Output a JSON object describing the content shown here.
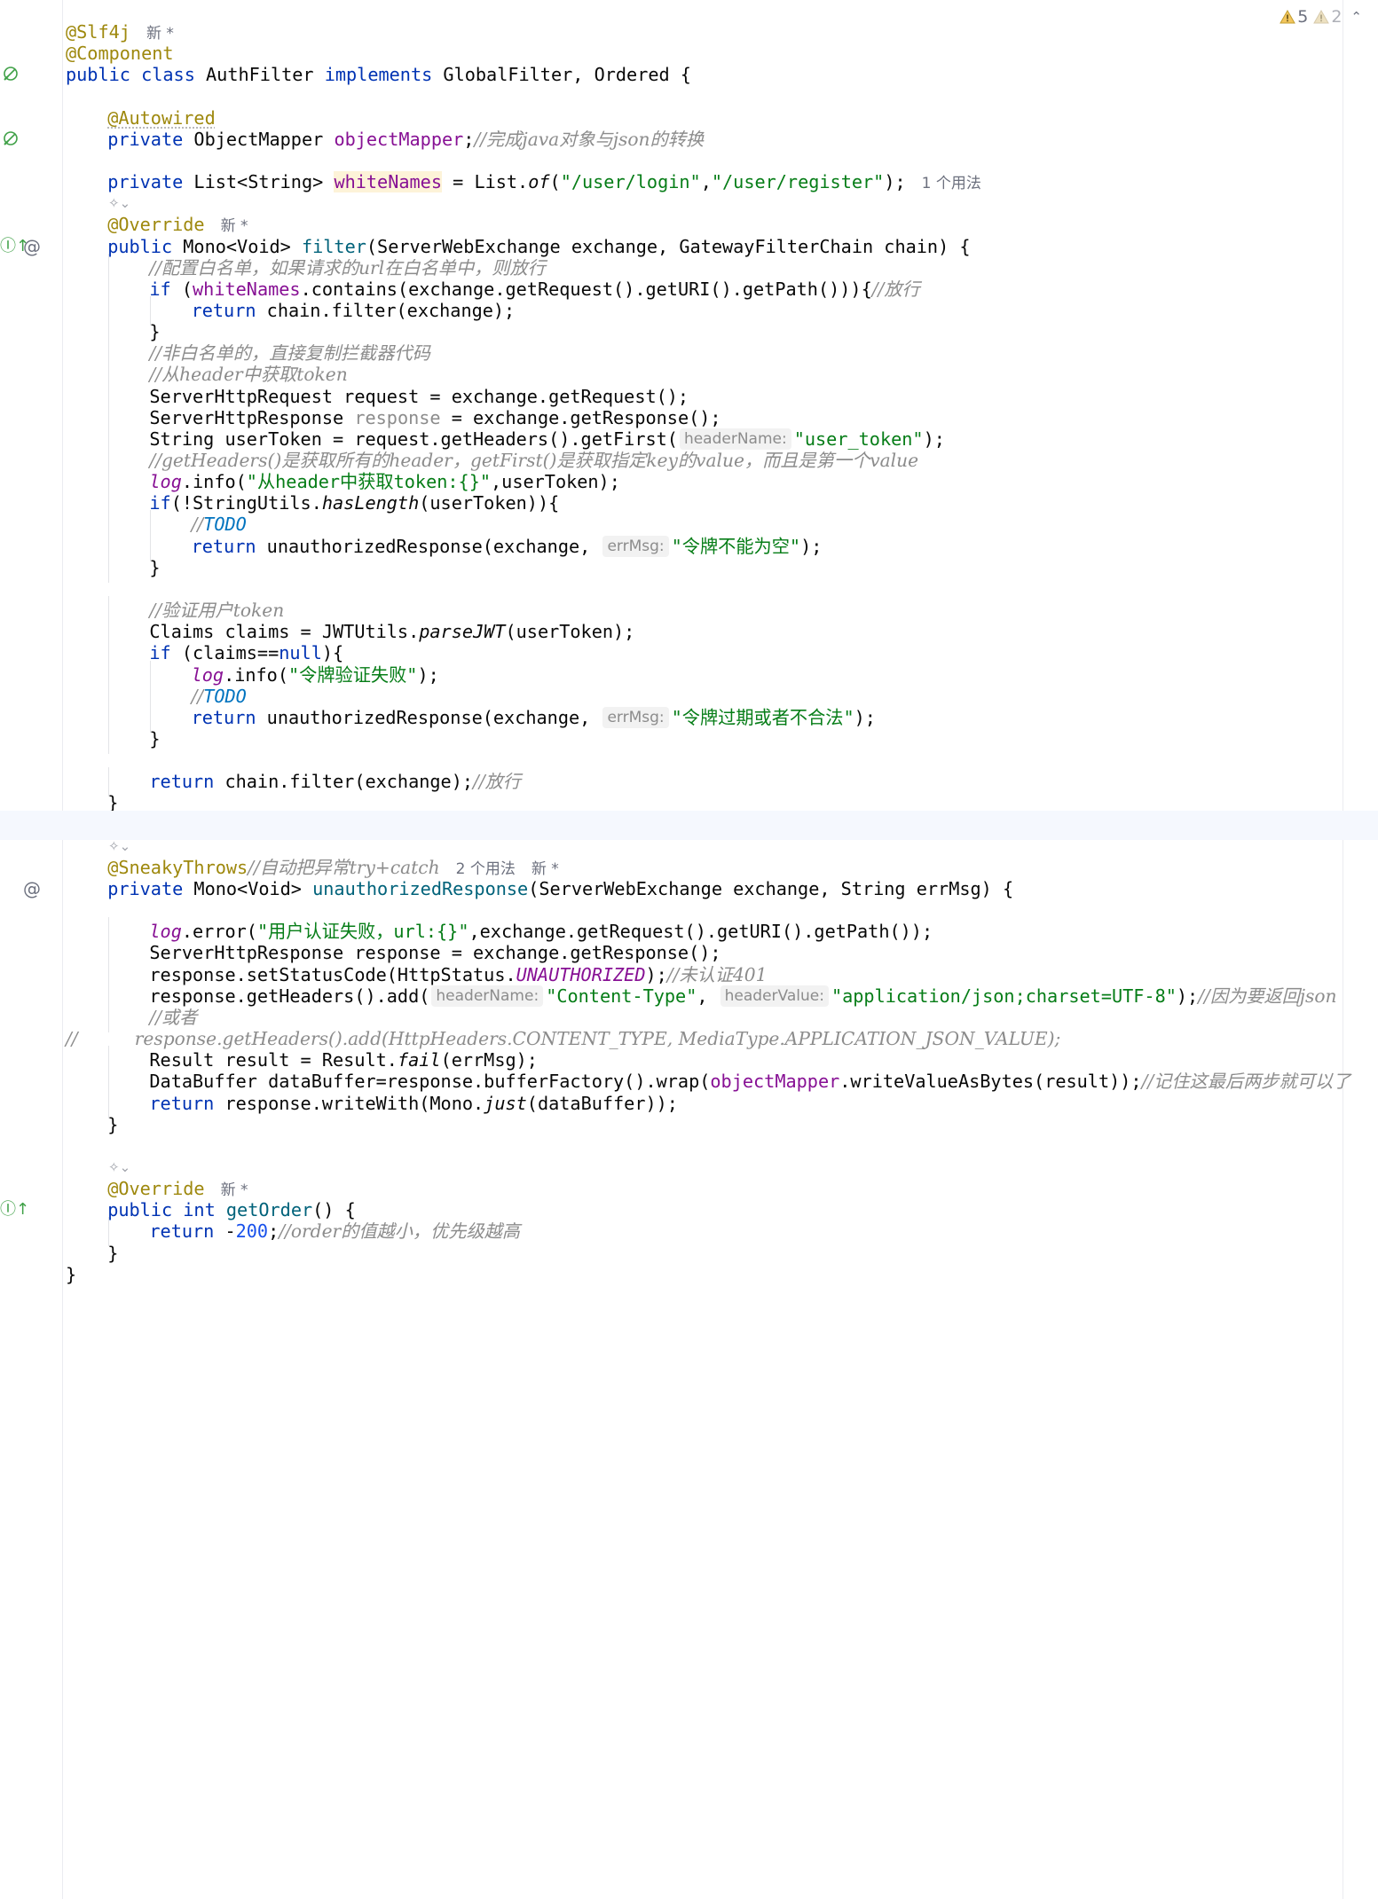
{
  "inspections": {
    "warnings": "5",
    "weak_warnings": "2"
  },
  "lines": [
    {
      "t": [
        {
          "c": "ann",
          "v": "@Slf4j"
        },
        {
          "meta": "新 *"
        }
      ]
    },
    {
      "t": [
        {
          "c": "ann",
          "v": "@Component"
        }
      ]
    },
    {
      "g": [
        "bean"
      ],
      "t": [
        {
          "c": "kw",
          "v": "public class "
        },
        {
          "c": "cls",
          "v": "AuthFilter "
        },
        {
          "c": "kw",
          "v": "implements "
        },
        {
          "c": "cls",
          "v": "GlobalFilter, Ordered {"
        }
      ]
    },
    {
      "t": []
    },
    {
      "i": 1,
      "t": [
        {
          "c": "ann-ul",
          "v": "@Autowired"
        }
      ]
    },
    {
      "i": 1,
      "g": [
        "bean"
      ],
      "t": [
        {
          "c": "kw",
          "v": "private "
        },
        {
          "c": "cls",
          "v": "ObjectMapper "
        },
        {
          "c": "field",
          "v": "objectMapper"
        },
        {
          "c": "cls",
          "v": ";"
        },
        {
          "c": "cm",
          "v": "//完成java对象与json的转换"
        }
      ]
    },
    {
      "t": []
    },
    {
      "i": 1,
      "t": [
        {
          "c": "kw",
          "v": "private "
        },
        {
          "c": "cls",
          "v": "List<String> "
        },
        {
          "c": "field-hl",
          "v": "whiteNames"
        },
        {
          "c": "cls",
          "v": " = List."
        },
        {
          "c": "static-m",
          "v": "of"
        },
        {
          "c": "cls",
          "v": "("
        },
        {
          "c": "str",
          "v": "\"/user/login\""
        },
        {
          "c": "cls",
          "v": ","
        },
        {
          "c": "str",
          "v": "\"/user/register\""
        },
        {
          "c": "cls",
          "v": ");"
        },
        {
          "meta": "1 个用法"
        }
      ]
    },
    {
      "ai": true,
      "t": []
    },
    {
      "i": 1,
      "t": [
        {
          "c": "ann",
          "v": "@Override"
        },
        {
          "meta": "新 *"
        }
      ]
    },
    {
      "i": 1,
      "g": [
        "override",
        "at"
      ],
      "t": [
        {
          "c": "kw",
          "v": "public "
        },
        {
          "c": "cls",
          "v": "Mono<Void> "
        },
        {
          "c": "method",
          "v": "filter"
        },
        {
          "c": "cls",
          "v": "(ServerWebExchange exchange, GatewayFilterChain chain) {"
        }
      ]
    },
    {
      "i": 2,
      "t": [
        {
          "c": "cm",
          "v": "//配置白名单，如果请求的url在白名单中，则放行"
        }
      ]
    },
    {
      "i": 2,
      "t": [
        {
          "c": "kw",
          "v": "if "
        },
        {
          "c": "cls",
          "v": "("
        },
        {
          "c": "field",
          "v": "whiteNames"
        },
        {
          "c": "cls",
          "v": ".contains(exchange.getRequest().getURI().getPath())){"
        },
        {
          "c": "cm",
          "v": "//放行"
        }
      ]
    },
    {
      "i": 3,
      "t": [
        {
          "c": "kw",
          "v": "return "
        },
        {
          "c": "cls",
          "v": "chain.filter(exchange);"
        }
      ]
    },
    {
      "i": 2,
      "t": [
        {
          "c": "cls",
          "v": "}"
        }
      ]
    },
    {
      "i": 2,
      "t": [
        {
          "c": "cm",
          "v": "//非白名单的，直接复制拦截器代码"
        }
      ]
    },
    {
      "i": 2,
      "t": [
        {
          "c": "cm",
          "v": "//从header中获取token"
        }
      ]
    },
    {
      "i": 2,
      "t": [
        {
          "c": "cls",
          "v": "ServerHttpRequest request = exchange.getRequest();"
        }
      ]
    },
    {
      "i": 2,
      "t": [
        {
          "c": "cls",
          "v": "ServerHttpResponse "
        },
        {
          "c": "unused",
          "v": "response"
        },
        {
          "c": "cls",
          "v": " = exchange.getResponse();"
        }
      ]
    },
    {
      "i": 2,
      "t": [
        {
          "c": "cls",
          "v": "String userToken = request.getHeaders().getFirst("
        },
        {
          "hint": "headerName:"
        },
        {
          "c": "str",
          "v": "\"user_token\""
        },
        {
          "c": "cls",
          "v": ");"
        }
      ]
    },
    {
      "i": 2,
      "t": [
        {
          "c": "cm",
          "v": "//getHeaders()是获取所有的header，getFirst()是获取指定key的value，而且是第一个value"
        }
      ]
    },
    {
      "i": 2,
      "t": [
        {
          "c": "static-f",
          "v": "log"
        },
        {
          "c": "cls",
          "v": ".info("
        },
        {
          "c": "str",
          "v": "\"从header中获取token:{}\""
        },
        {
          "c": "cls",
          "v": ",userToken);"
        }
      ]
    },
    {
      "i": 2,
      "t": [
        {
          "c": "kw",
          "v": "if"
        },
        {
          "c": "cls",
          "v": "(!StringUtils."
        },
        {
          "c": "static-m",
          "v": "hasLength"
        },
        {
          "c": "cls",
          "v": "(userToken)){"
        }
      ]
    },
    {
      "i": 3,
      "t": [
        {
          "c": "cm",
          "v": "//"
        },
        {
          "c": "todo",
          "v": "TODO"
        }
      ]
    },
    {
      "i": 3,
      "t": [
        {
          "c": "kw",
          "v": "return "
        },
        {
          "c": "cls",
          "v": "unauthorizedResponse(exchange, "
        },
        {
          "hint": "errMsg:"
        },
        {
          "c": "str",
          "v": "\"令牌不能为空\""
        },
        {
          "c": "cls",
          "v": ");"
        }
      ]
    },
    {
      "i": 2,
      "t": [
        {
          "c": "cls",
          "v": "}"
        }
      ]
    },
    {
      "t": []
    },
    {
      "i": 2,
      "t": [
        {
          "c": "cm",
          "v": "//验证用户token"
        }
      ]
    },
    {
      "i": 2,
      "t": [
        {
          "c": "cls",
          "v": "Claims claims = JWTUtils."
        },
        {
          "c": "static-m",
          "v": "parseJWT"
        },
        {
          "c": "cls",
          "v": "(userToken);"
        }
      ]
    },
    {
      "i": 2,
      "t": [
        {
          "c": "kw",
          "v": "if "
        },
        {
          "c": "cls",
          "v": "(claims=="
        },
        {
          "c": "kw",
          "v": "null"
        },
        {
          "c": "cls",
          "v": "){"
        }
      ]
    },
    {
      "i": 3,
      "t": [
        {
          "c": "static-f",
          "v": "log"
        },
        {
          "c": "cls",
          "v": ".info("
        },
        {
          "c": "str",
          "v": "\"令牌验证失败\""
        },
        {
          "c": "cls",
          "v": ");"
        }
      ]
    },
    {
      "i": 3,
      "t": [
        {
          "c": "cm",
          "v": "//"
        },
        {
          "c": "todo",
          "v": "TODO"
        }
      ]
    },
    {
      "i": 3,
      "t": [
        {
          "c": "kw",
          "v": "return "
        },
        {
          "c": "cls",
          "v": "unauthorizedResponse(exchange, "
        },
        {
          "hint": "errMsg:"
        },
        {
          "c": "str",
          "v": "\"令牌过期或者不合法\""
        },
        {
          "c": "cls",
          "v": ");"
        }
      ]
    },
    {
      "i": 2,
      "t": [
        {
          "c": "cls",
          "v": "}"
        }
      ]
    },
    {
      "t": []
    },
    {
      "i": 2,
      "t": [
        {
          "c": "kw",
          "v": "return "
        },
        {
          "c": "cls",
          "v": "chain.filter(exchange);"
        },
        {
          "c": "cm",
          "v": "//放行"
        }
      ]
    },
    {
      "i": 1,
      "t": [
        {
          "c": "cls",
          "v": "}"
        }
      ]
    },
    {
      "current": true,
      "t": []
    },
    {
      "ai": true,
      "t": []
    },
    {
      "i": 1,
      "t": [
        {
          "c": "ann",
          "v": "@SneakyThrows"
        },
        {
          "c": "cm",
          "v": "//自动把异常try+catch"
        },
        {
          "meta": "2 个用法"
        },
        {
          "meta": "新 *"
        }
      ]
    },
    {
      "i": 1,
      "g": [
        "at2"
      ],
      "t": [
        {
          "c": "kw",
          "v": "private "
        },
        {
          "c": "cls",
          "v": "Mono<Void> "
        },
        {
          "c": "method",
          "v": "unauthorizedResponse"
        },
        {
          "c": "cls",
          "v": "(ServerWebExchange exchange, String errMsg) {"
        }
      ]
    },
    {
      "t": []
    },
    {
      "i": 2,
      "t": [
        {
          "c": "static-f",
          "v": "log"
        },
        {
          "c": "cls",
          "v": ".error("
        },
        {
          "c": "str",
          "v": "\"用户认证失败，url:{}\""
        },
        {
          "c": "cls",
          "v": ",exchange.getRequest().getURI().getPath());"
        }
      ]
    },
    {
      "i": 2,
      "t": [
        {
          "c": "cls",
          "v": "ServerHttpResponse response = exchange.getResponse();"
        }
      ]
    },
    {
      "i": 2,
      "t": [
        {
          "c": "cls",
          "v": "response.setStatusCode(HttpStatus."
        },
        {
          "c": "static-f",
          "v": "UNAUTHORIZED"
        },
        {
          "c": "cls",
          "v": ");"
        },
        {
          "c": "cm",
          "v": "//未认证401"
        }
      ]
    },
    {
      "i": 2,
      "t": [
        {
          "c": "cls",
          "v": "response.getHeaders().add("
        },
        {
          "hint": "headerName:"
        },
        {
          "c": "str",
          "v": "\"Content-Type\""
        },
        {
          "c": "cls",
          "v": ", "
        },
        {
          "hint": "headerValue:"
        },
        {
          "c": "str",
          "v": "\"application/json;charset=UTF-8\""
        },
        {
          "c": "cls",
          "v": ");"
        },
        {
          "c": "cm",
          "v": "//因为要返回json"
        }
      ]
    },
    {
      "i": 2,
      "t": [
        {
          "c": "cm",
          "v": "//或者"
        }
      ]
    },
    {
      "t": [
        {
          "c": "cm",
          "v": "//          response.getHeaders().add(HttpHeaders.CONTENT_TYPE, MediaType.APPLICATION_JSON_VALUE);"
        }
      ]
    },
    {
      "i": 2,
      "t": [
        {
          "c": "cls",
          "v": "Result result = Result."
        },
        {
          "c": "static-m",
          "v": "fail"
        },
        {
          "c": "cls",
          "v": "(errMsg);"
        }
      ]
    },
    {
      "i": 2,
      "t": [
        {
          "c": "cls",
          "v": "DataBuffer dataBuffer=response.bufferFactory().wrap("
        },
        {
          "c": "field",
          "v": "objectMapper"
        },
        {
          "c": "cls",
          "v": ".writeValueAsBytes(result));"
        },
        {
          "c": "cm",
          "v": "//记住这最后两步就可以了"
        }
      ]
    },
    {
      "i": 2,
      "t": [
        {
          "c": "kw",
          "v": "return "
        },
        {
          "c": "cls",
          "v": "response.writeWith(Mono."
        },
        {
          "c": "static-m",
          "v": "just"
        },
        {
          "c": "cls",
          "v": "(dataBuffer));"
        }
      ]
    },
    {
      "i": 1,
      "t": [
        {
          "c": "cls",
          "v": "}"
        }
      ]
    },
    {
      "t": []
    },
    {
      "ai": true,
      "t": []
    },
    {
      "i": 1,
      "t": [
        {
          "c": "ann",
          "v": "@Override"
        },
        {
          "meta": "新 *"
        }
      ]
    },
    {
      "i": 1,
      "g": [
        "override"
      ],
      "t": [
        {
          "c": "kw",
          "v": "public int "
        },
        {
          "c": "method",
          "v": "getOrder"
        },
        {
          "c": "cls",
          "v": "() {"
        }
      ]
    },
    {
      "i": 2,
      "t": [
        {
          "c": "kw",
          "v": "return "
        },
        {
          "c": "cls",
          "v": "-"
        },
        {
          "c": "num",
          "v": "200"
        },
        {
          "c": "cls",
          "v": ";"
        },
        {
          "c": "cm",
          "v": "//order的值越小，优先级越高"
        }
      ]
    },
    {
      "i": 1,
      "t": [
        {
          "c": "cls",
          "v": "}"
        }
      ]
    },
    {
      "t": [
        {
          "c": "cls",
          "v": "}"
        }
      ]
    }
  ]
}
